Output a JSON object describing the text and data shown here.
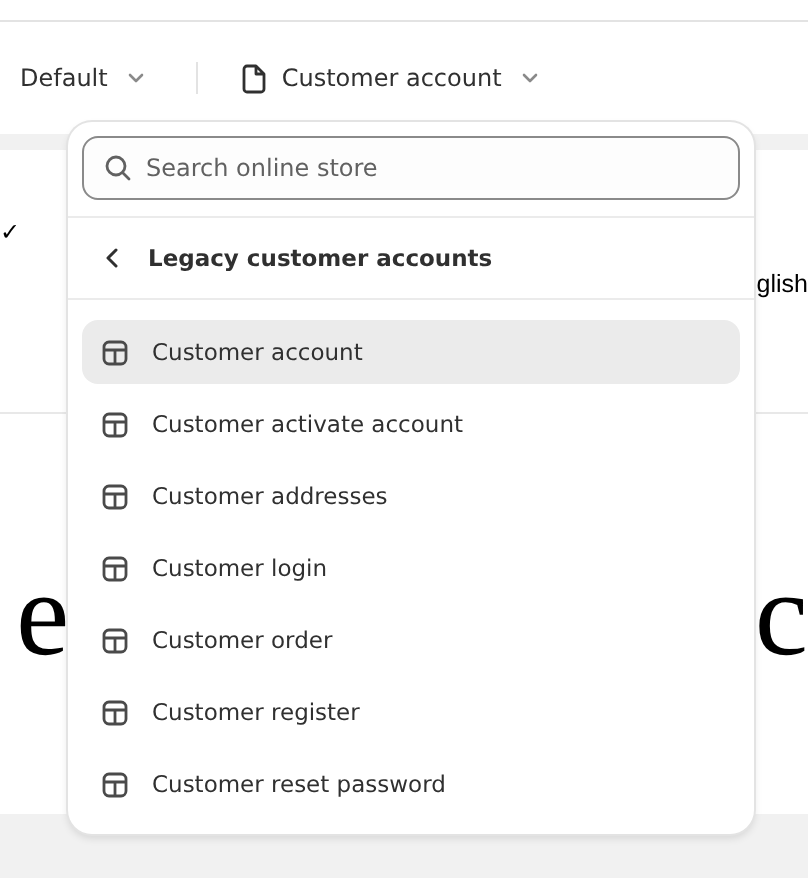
{
  "toolbar": {
    "theme_menu": {
      "label": "Default"
    },
    "template_menu": {
      "label": "Customer account"
    }
  },
  "page": {
    "check_mark": "✓",
    "language_fragment": "glish",
    "heading_left_fragment": "e",
    "heading_right_fragment": "c"
  },
  "dropdown": {
    "search": {
      "placeholder": "Search online store"
    },
    "back_label": "Legacy customer accounts",
    "items": [
      {
        "label": "Customer account",
        "selected": true
      },
      {
        "label": "Customer activate account",
        "selected": false
      },
      {
        "label": "Customer addresses",
        "selected": false
      },
      {
        "label": "Customer login",
        "selected": false
      },
      {
        "label": "Customer order",
        "selected": false
      },
      {
        "label": "Customer register",
        "selected": false
      },
      {
        "label": "Customer reset password",
        "selected": false
      }
    ]
  }
}
